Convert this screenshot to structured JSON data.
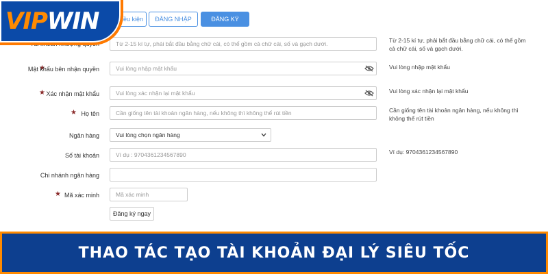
{
  "brand": {
    "vip": "VIP",
    "win": "WIN"
  },
  "tabs": [
    {
      "label": "điều kiện"
    },
    {
      "label": "ĐĂNG NHẬP"
    },
    {
      "label": "ĐĂNG KÝ"
    }
  ],
  "form": {
    "username": {
      "label": "Tài khoản nhượng quyền",
      "placeholder": "Từ 2-15 kí tự, phải bắt đầu bằng chữ cái, có thể  gồm cả chữ cái, số và gạch dưới.",
      "hint": "Từ 2-15 kí tự, phải bắt đầu bằng chữ cái, có thể gồm cả chữ cái, số và gạch dưới."
    },
    "password": {
      "label": "Mật khẩu bên nhận quyền",
      "placeholder": "Vui lòng nhập mật khẩu",
      "hint": "Vui lòng nhập mật khẩu"
    },
    "confirm_password": {
      "label": "Xác nhận mật khẩu",
      "placeholder": "Vui lòng xác nhận lại mật khẩu",
      "hint": "Vui lòng xác nhận lại mật khẩu"
    },
    "full_name": {
      "label": "Họ tên",
      "placeholder": "Cần giống tên tài khoản ngân hàng, nếu không thì không thể rút tiền",
      "hint": "Cần giống tên tài khoản ngân hàng, nếu không thì không thể rút tiền"
    },
    "bank": {
      "label": "Ngân hàng",
      "value": "Vui lòng chọn ngân hàng"
    },
    "account_number": {
      "label": "Số tài khoản",
      "placeholder": "Ví dụ : 9704361234567890",
      "hint": "Ví dụ:   9704361234567890"
    },
    "branch": {
      "label": "Chi nhánh ngân hàng",
      "placeholder": ""
    },
    "captcha": {
      "label": "Mã xác minh",
      "placeholder": "Mã xác minh"
    },
    "submit_label": "Đăng ký ngay"
  },
  "banner": {
    "title": "THAO TÁC TẠO TÀI KHOẢN ĐẠI LÝ SIÊU TỐC"
  },
  "colors": {
    "brand_blue": "#0d3f8f",
    "brand_orange": "#ff8a00",
    "tab_blue": "#4a90e2",
    "star_red": "#8a2a2a"
  }
}
